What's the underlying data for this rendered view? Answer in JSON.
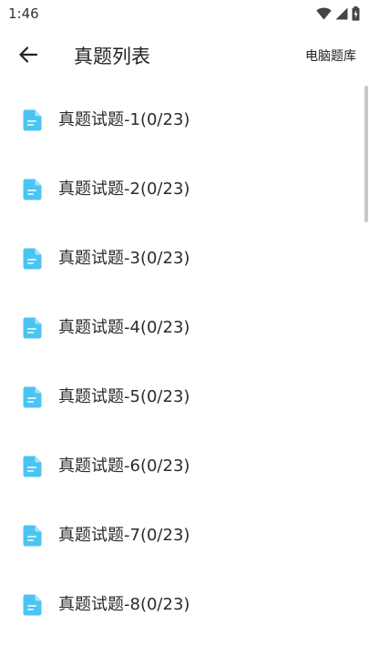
{
  "status_bar": {
    "time": "1:46",
    "icons": [
      "wifi-icon",
      "cell-signal-icon",
      "battery-charging-icon"
    ]
  },
  "app_bar": {
    "back_icon": "arrow-left-icon",
    "title": "真题列表",
    "action_label": "电脑题库"
  },
  "list": {
    "item_icon": "document-icon",
    "icon_color": "#4cc4f2",
    "items": [
      {
        "label": "真题试题-1(0/23)"
      },
      {
        "label": "真题试题-2(0/23)"
      },
      {
        "label": "真题试题-3(0/23)"
      },
      {
        "label": "真题试题-4(0/23)"
      },
      {
        "label": "真题试题-5(0/23)"
      },
      {
        "label": "真题试题-6(0/23)"
      },
      {
        "label": "真题试题-7(0/23)"
      },
      {
        "label": "真题试题-8(0/23)"
      }
    ]
  },
  "colors": {
    "background": "#ffffff",
    "text": "#222222",
    "scrollbar": "#c8c8c8"
  }
}
